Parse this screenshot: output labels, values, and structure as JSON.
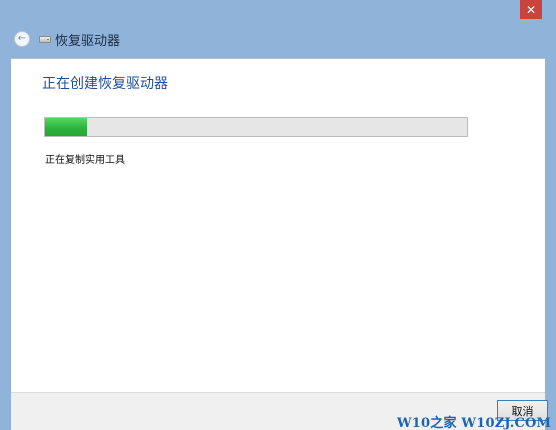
{
  "window": {
    "title": "恢复驱动器",
    "close_glyph": "✕"
  },
  "nav": {
    "back_glyph": "←"
  },
  "main": {
    "heading": "正在创建恢复驱动器",
    "progress_fraction": 0.1,
    "progress_color": "#2fb23f",
    "status": "正在复制实用工具"
  },
  "footer": {
    "cancel_label": "取消"
  },
  "watermark": {
    "text": "W10之家 W10ZJ.COM"
  }
}
